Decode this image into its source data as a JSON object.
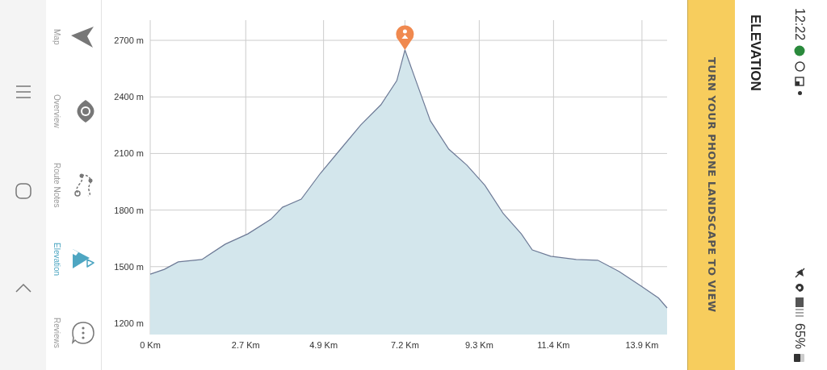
{
  "sidebar": {
    "items": [
      {
        "label": "Map",
        "kind": "map",
        "selected": false
      },
      {
        "label": "Overview",
        "kind": "overview",
        "selected": false
      },
      {
        "label": "Route Notes",
        "kind": "notes",
        "selected": false
      },
      {
        "label": "Elevation",
        "kind": "elevation",
        "selected": true
      },
      {
        "label": "Reviews",
        "kind": "reviews",
        "selected": false
      }
    ]
  },
  "elevation": {
    "chart_data": {
      "type": "area",
      "x": [
        0,
        0.4,
        0.79,
        1.46,
        2.12,
        2.76,
        3.41,
        3.74,
        4.27,
        4.81,
        5.38,
        5.95,
        6.52,
        6.97,
        7.2,
        7.51,
        7.92,
        8.44,
        8.95,
        9.46,
        9.98,
        10.49,
        10.8,
        11.32,
        12.04,
        12.65,
        13.26,
        13.88,
        14.37,
        14.61
      ],
      "values": [
        1460,
        1486,
        1525,
        1538,
        1619,
        1674,
        1751,
        1815,
        1858,
        1995,
        2123,
        2251,
        2358,
        2486,
        2649,
        2486,
        2273,
        2123,
        2038,
        1931,
        1781,
        1674,
        1589,
        1555,
        1538,
        1534,
        1474,
        1397,
        1333,
        1281
      ],
      "xlim": [
        0,
        14.61
      ],
      "ylim": [
        1140,
        2807
      ],
      "grid": true,
      "yticks": [
        {
          "value": 1200,
          "label": "1200 m"
        },
        {
          "value": 1500,
          "label": "1500 m"
        },
        {
          "value": 1800,
          "label": "1800 m"
        },
        {
          "value": 2100,
          "label": "2100 m"
        },
        {
          "value": 2400,
          "label": "2400 m"
        },
        {
          "value": 2700,
          "label": "2700 m"
        }
      ],
      "xticks": [
        {
          "value": 0,
          "label": "0 Km"
        },
        {
          "value": 2.7,
          "label": "2.7 Km"
        },
        {
          "value": 4.9,
          "label": "4.9 Km"
        },
        {
          "value": 7.2,
          "label": "7.2 Km"
        },
        {
          "value": 9.3,
          "label": "9.3 Km"
        },
        {
          "value": 11.4,
          "label": "11.4 Km"
        },
        {
          "value": 13.9,
          "label": "13.9 Km"
        }
      ]
    }
  },
  "banner": {
    "text": "TURN YOUR PHONE LANDSCAPE TO VIEW"
  },
  "header": {
    "title": "ELEVATION"
  },
  "status_bar": {
    "time": "12:22",
    "battery": "65%"
  }
}
